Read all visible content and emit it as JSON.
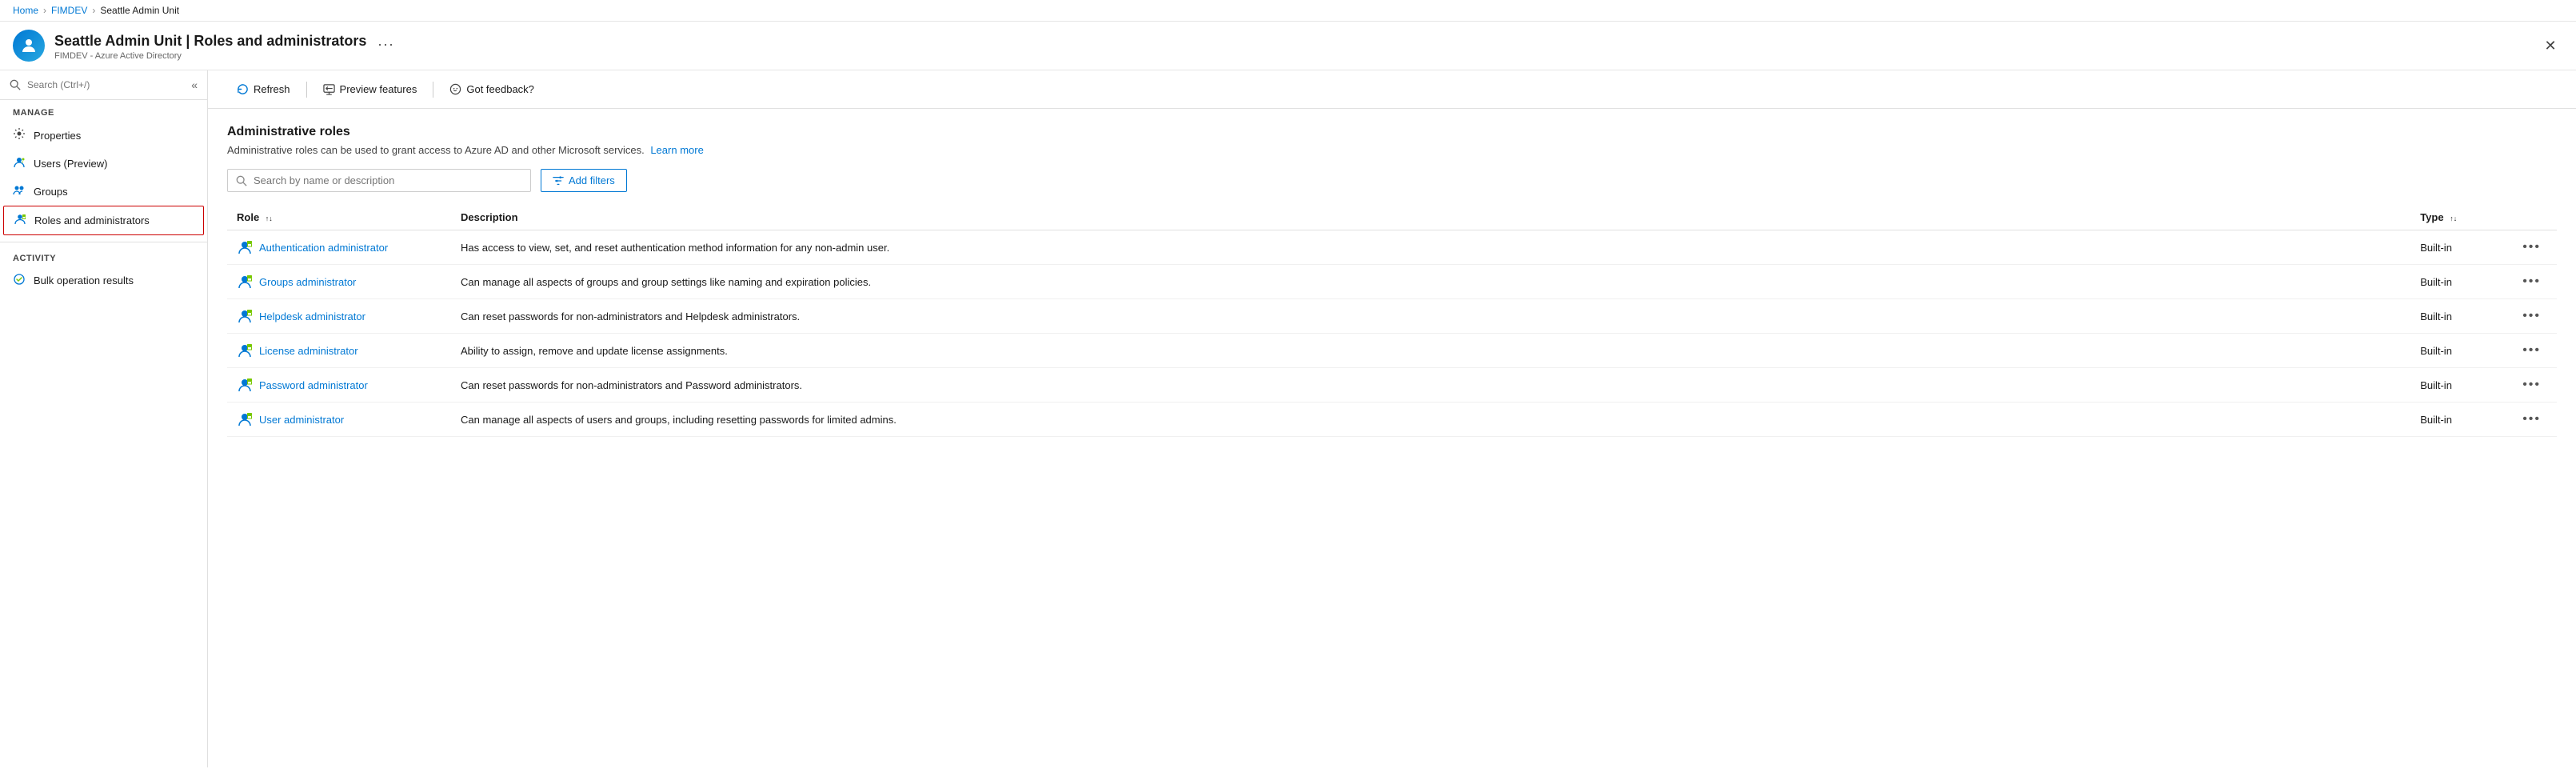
{
  "breadcrumb": {
    "items": [
      "Home",
      "FIMDEV",
      "Seattle Admin Unit"
    ]
  },
  "header": {
    "title": "Seattle Admin Unit | Roles and administrators",
    "subtitle": "FIMDEV - Azure Active Directory",
    "more_label": "...",
    "close_label": "✕"
  },
  "sidebar": {
    "search_placeholder": "Search (Ctrl+/)",
    "collapse_label": "«",
    "manage_label": "Manage",
    "nav_items": [
      {
        "id": "properties",
        "label": "Properties",
        "icon": "⚙"
      },
      {
        "id": "users",
        "label": "Users (Preview)",
        "icon": "👤"
      },
      {
        "id": "groups",
        "label": "Groups",
        "icon": "👥"
      },
      {
        "id": "roles",
        "label": "Roles and administrators",
        "icon": "👤",
        "active": true
      }
    ],
    "activity_label": "Activity",
    "activity_items": [
      {
        "id": "bulk-ops",
        "label": "Bulk operation results",
        "icon": "♻"
      }
    ]
  },
  "toolbar": {
    "refresh_label": "Refresh",
    "preview_label": "Preview features",
    "feedback_label": "Got feedback?"
  },
  "content": {
    "title": "Administrative roles",
    "description": "Administrative roles can be used to grant access to Azure AD and other Microsoft services.",
    "learn_more": "Learn more",
    "search_placeholder": "Search by name or description",
    "add_filters_label": "Add filters",
    "table": {
      "columns": [
        {
          "id": "role",
          "label": "Role"
        },
        {
          "id": "description",
          "label": "Description"
        },
        {
          "id": "type",
          "label": "Type"
        }
      ],
      "rows": [
        {
          "role": "Authentication administrator",
          "description": "Has access to view, set, and reset authentication method information for any non-admin user.",
          "type": "Built-in"
        },
        {
          "role": "Groups administrator",
          "description": "Can manage all aspects of groups and group settings like naming and expiration policies.",
          "type": "Built-in"
        },
        {
          "role": "Helpdesk administrator",
          "description": "Can reset passwords for non-administrators and Helpdesk administrators.",
          "type": "Built-in"
        },
        {
          "role": "License administrator",
          "description": "Ability to assign, remove and update license assignments.",
          "type": "Built-in"
        },
        {
          "role": "Password administrator",
          "description": "Can reset passwords for non-administrators and Password administrators.",
          "type": "Built-in"
        },
        {
          "role": "User administrator",
          "description": "Can manage all aspects of users and groups, including resetting passwords for limited admins.",
          "type": "Built-in"
        }
      ]
    }
  }
}
